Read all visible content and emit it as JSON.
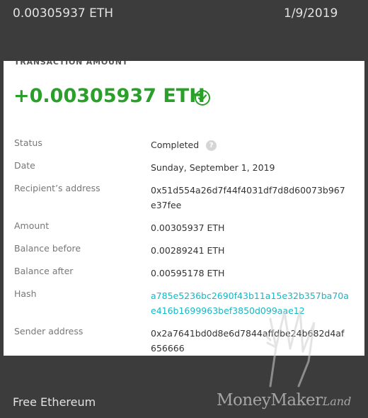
{
  "top": {
    "amount": "0.00305937 ETH",
    "date": "1/9/2019"
  },
  "card": {
    "section_label": "TRANSACTION AMOUNT",
    "amount": "+0.00305937 ETH",
    "rows": [
      {
        "label": "Status",
        "value": "Completed"
      },
      {
        "label": "Date",
        "value": "Sunday, September 1, 2019"
      },
      {
        "label": "Recipient’s address",
        "value": "0x51d554a26d7f44f4031df7d8d60073b967e37fee"
      },
      {
        "label": "Amount",
        "value": "0.00305937 ETH"
      },
      {
        "label": "Balance before",
        "value": "0.00289241 ETH"
      },
      {
        "label": "Balance after",
        "value": "0.00595178 ETH"
      },
      {
        "label": "Hash",
        "value": "a785e5236bc2690f43b11a15e32b357ba70ae416b1699963bef3850d099aae12"
      },
      {
        "label": "Sender address",
        "value": "0x2a7641bd0d8e6d7844affdbe24b682d4af656666"
      }
    ]
  },
  "footer": {
    "left": "Free Ethereum",
    "brand_main": "MoneyMaker",
    "brand_script": "Land"
  },
  "colors": {
    "positive": "#2aa02a",
    "hash_link": "#17b7c4"
  },
  "icons": {
    "status_help": "question-icon",
    "amount_check": "check-circle-icon"
  }
}
